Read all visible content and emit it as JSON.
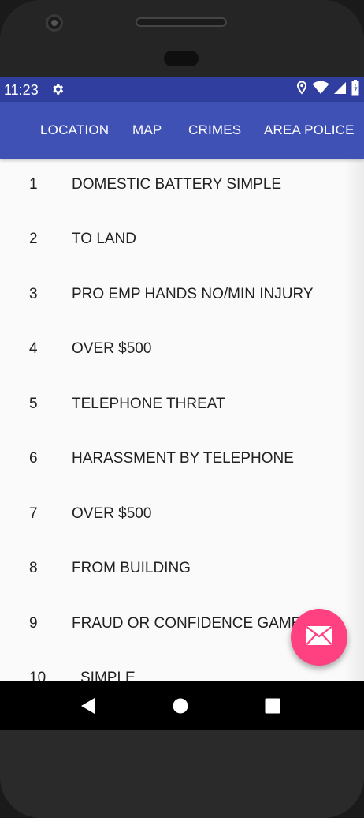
{
  "status_bar": {
    "time": "11:23",
    "icons": [
      "settings-gear-icon",
      "location-pin-icon",
      "wifi-icon",
      "signal-icon",
      "battery-icon"
    ],
    "background": "#303f9f"
  },
  "app_bar": {
    "background": "#3f51b5",
    "tabs": [
      {
        "label": "LOCATION"
      },
      {
        "label": "MAP"
      },
      {
        "label": "CRIMES"
      },
      {
        "label": "AREA POLICE"
      }
    ]
  },
  "list": {
    "items": [
      {
        "number": "1",
        "text": "DOMESTIC BATTERY SIMPLE"
      },
      {
        "number": "2",
        "text": "TO LAND"
      },
      {
        "number": "3",
        "text": "PRO EMP HANDS NO/MIN INJURY"
      },
      {
        "number": "4",
        "text": "OVER $500"
      },
      {
        "number": "5",
        "text": "TELEPHONE THREAT"
      },
      {
        "number": "6",
        "text": "HARASSMENT BY TELEPHONE"
      },
      {
        "number": "7",
        "text": "OVER $500"
      },
      {
        "number": "8",
        "text": "FROM BUILDING"
      },
      {
        "number": "9",
        "text": "FRAUD OR CONFIDENCE GAME"
      },
      {
        "number": "10",
        "text": "SIMPLE"
      }
    ]
  },
  "fab": {
    "icon": "mail-envelope-icon",
    "color": "#ff4081"
  },
  "nav_bar": {
    "buttons": [
      "back-icon",
      "home-icon",
      "recents-icon"
    ]
  }
}
